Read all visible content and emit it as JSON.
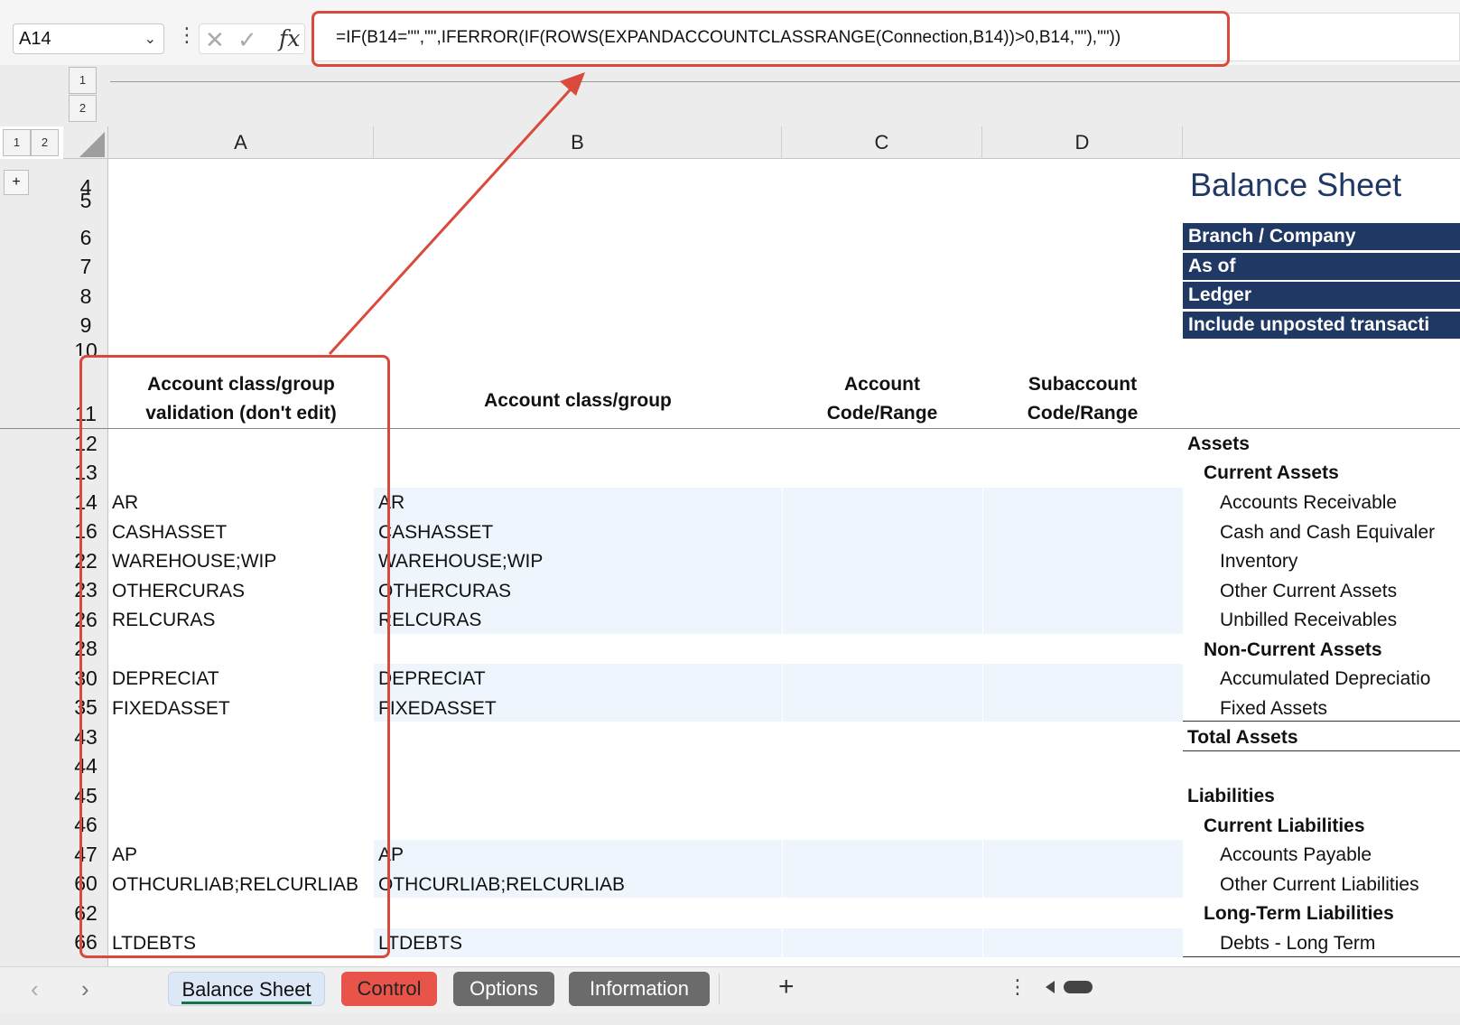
{
  "formula_bar": {
    "name_box": "A14",
    "formula": "=IF(B14=\"\",\"\",IFERROR(IF(ROWS(EXPANDACCOUNTCLASSRANGE(Connection,B14))>0,B14,\"\"),\"\"))"
  },
  "outline": {
    "row_levels": [
      "1",
      "2"
    ],
    "col_levels": [
      "1",
      "2"
    ],
    "expand": "+"
  },
  "columns": [
    "A",
    "B",
    "C",
    "D"
  ],
  "rows": [
    "4",
    "5",
    "6",
    "7",
    "8",
    "9",
    "10",
    "11",
    "12",
    "13",
    "14",
    "16",
    "22",
    "23",
    "26",
    "28",
    "30",
    "35",
    "43",
    "44",
    "45",
    "46",
    "47",
    "60",
    "62",
    "66"
  ],
  "headers": {
    "a_line1": "Account class/group",
    "a_line2": "validation (don't edit)",
    "b": "Account class/group",
    "c_line1": "Account",
    "c_line2": "Code/Range",
    "d_line1": "Subaccount",
    "d_line2": "Code/Range"
  },
  "cells": {
    "a14": "AR",
    "b14": "AR",
    "a16": "CASHASSET",
    "b16": "CASHASSET",
    "a22": "WAREHOUSE;WIP",
    "b22": "WAREHOUSE;WIP",
    "a23": "OTHERCURAS",
    "b23": "OTHERCURAS",
    "a26": "RELCURAS",
    "b26": "RELCURAS",
    "a30": "DEPRECIAT",
    "b30": "DEPRECIAT",
    "a35": "FIXEDASSET",
    "b35": "FIXEDASSET",
    "a47": "AP",
    "b47": "AP",
    "a60": "OTHCURLIAB;RELCURLIAB",
    "b60": "OTHCURLIAB;RELCURLIAB",
    "a66": "LTDEBTS",
    "b66": "LTDEBTS"
  },
  "balance_sheet": {
    "title": "Balance Sheet",
    "params": [
      "Branch / Company",
      "As of",
      "Ledger",
      "Include unposted transacti"
    ],
    "items": {
      "assets": "Assets",
      "current_assets": "Current Assets",
      "accounts_receivable": "Accounts Receivable",
      "cash": "Cash and Cash Equivaler",
      "inventory": "Inventory",
      "other_current_assets": "Other Current Assets",
      "unbilled": "Unbilled Receivables",
      "non_current_assets": "Non-Current Assets",
      "accum_dep": "Accumulated Depreciatio",
      "fixed_assets": "Fixed Assets",
      "total_assets": "Total Assets",
      "liabilities": "Liabilities",
      "current_liabilities": "Current Liabilities",
      "accounts_payable": "Accounts Payable",
      "other_current_liabilities": "Other Current Liabilities",
      "long_term_liabilities": "Long-Term Liabilities",
      "debts_long_term": "Debts - Long Term"
    }
  },
  "sheet_tabs": {
    "balance_sheet": "Balance Sheet",
    "control": "Control",
    "options": "Options",
    "information": "Information",
    "add": "+"
  },
  "colors": {
    "annotation_red": "#d9493c",
    "navy": "#1f3864",
    "input_blue": "#eef5fd",
    "control_tab": "#e8544a",
    "gray_tab": "#6b6b6b"
  }
}
